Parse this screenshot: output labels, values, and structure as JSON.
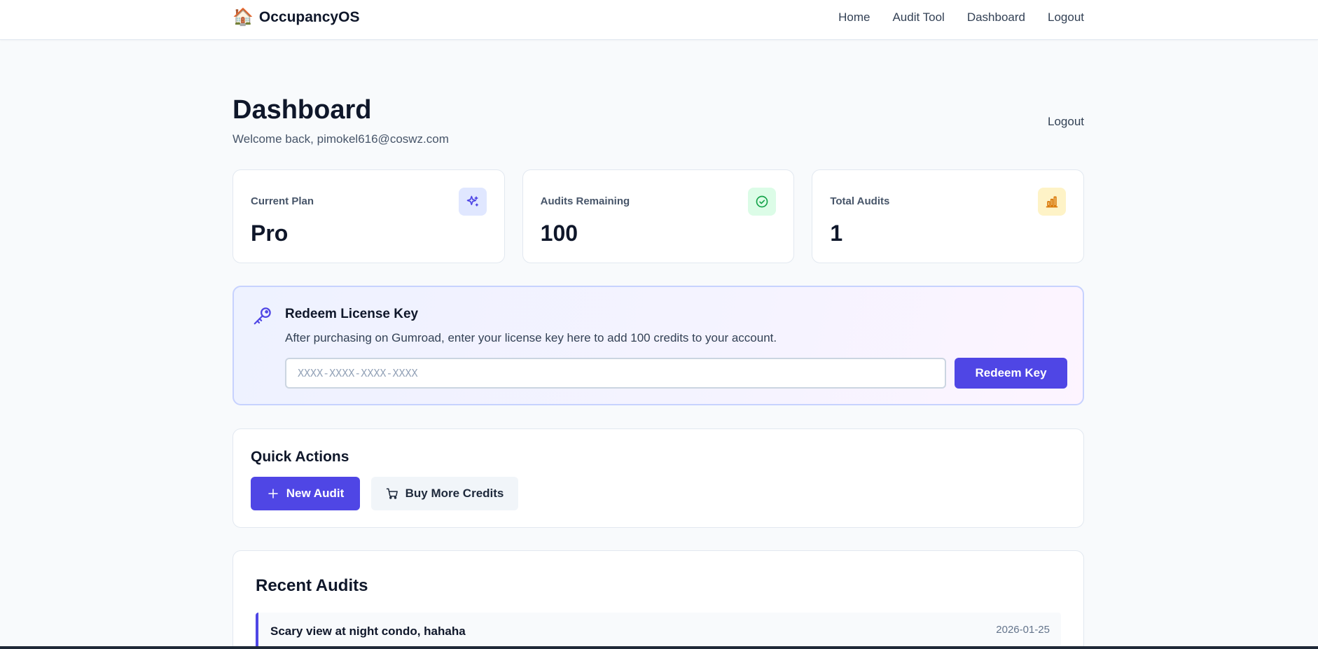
{
  "navbar": {
    "brand_icon": "🏠",
    "brand": "OccupancyOS",
    "links": [
      "Home",
      "Audit Tool",
      "Dashboard",
      "Logout"
    ]
  },
  "header": {
    "title": "Dashboard",
    "welcome": "Welcome back, pimokel616@coswz.com",
    "logout": "Logout"
  },
  "stats": [
    {
      "label": "Current Plan",
      "value": "Pro",
      "icon": "sparkles-icon",
      "color": "#4f46e5"
    },
    {
      "label": "Audits Remaining",
      "value": "100",
      "icon": "check-circle-icon",
      "color": "#16a34a"
    },
    {
      "label": "Total Audits",
      "value": "1",
      "icon": "bar-chart-icon",
      "color": "#d97706"
    }
  ],
  "redeem": {
    "title": "Redeem License Key",
    "description": "After purchasing on Gumroad, enter your license key here to add 100 credits to your account.",
    "placeholder": "XXXX-XXXX-XXXX-XXXX",
    "value": "",
    "button": "Redeem Key"
  },
  "quick_actions": {
    "title": "Quick Actions",
    "new_audit": "New Audit",
    "buy_credits": "Buy More Credits"
  },
  "recent_audits": {
    "title": "Recent Audits",
    "items": [
      {
        "title": "Scary view at night condo, hahaha",
        "date": "2026-01-25"
      }
    ]
  },
  "colors": {
    "accent": "#4f46e5",
    "background": "#f8fafc"
  }
}
